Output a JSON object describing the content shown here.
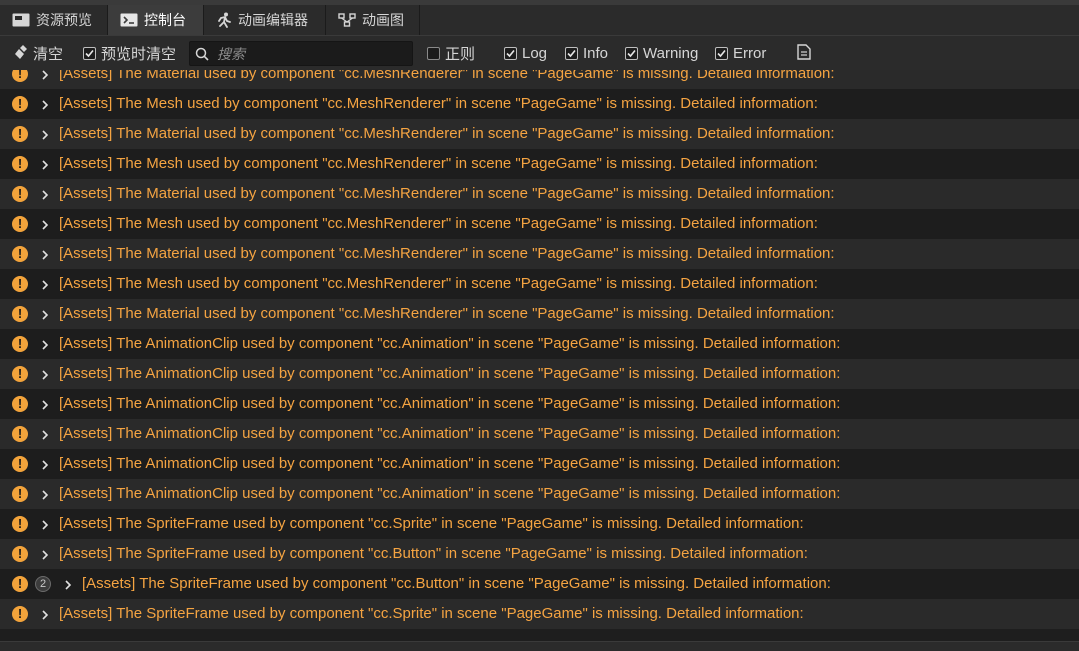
{
  "tabs": [
    {
      "label": "资源预览",
      "icon": "image-icon"
    },
    {
      "label": "控制台",
      "icon": "terminal-icon"
    },
    {
      "label": "动画编辑器",
      "icon": "running-figure-icon"
    },
    {
      "label": "动画图",
      "icon": "graph-icon"
    }
  ],
  "toolbar": {
    "clear_label": "清空",
    "preview_clear_label": "预览时清空",
    "search_placeholder": "搜索",
    "regex_label": "正则",
    "log_label": "Log",
    "info_label": "Info",
    "warning_label": "Warning",
    "error_label": "Error"
  },
  "filters": {
    "preview_clear": true,
    "regex": false,
    "log": true,
    "info": true,
    "warning": true,
    "error": true
  },
  "colors": {
    "warning_text": "#f5a442",
    "warning_icon": "#f2a33b"
  },
  "logs": [
    {
      "text": "[Assets] The Material used by component \"cc.MeshRenderer\" in scene \"PageGame\" is missing. Detailed information:"
    },
    {
      "text": "[Assets] The Mesh used by component \"cc.MeshRenderer\" in scene \"PageGame\" is missing. Detailed information:"
    },
    {
      "text": "[Assets] The Material used by component \"cc.MeshRenderer\" in scene \"PageGame\" is missing. Detailed information:"
    },
    {
      "text": "[Assets] The Mesh used by component \"cc.MeshRenderer\" in scene \"PageGame\" is missing. Detailed information:"
    },
    {
      "text": "[Assets] The Material used by component \"cc.MeshRenderer\" in scene \"PageGame\" is missing. Detailed information:"
    },
    {
      "text": "[Assets] The Mesh used by component \"cc.MeshRenderer\" in scene \"PageGame\" is missing. Detailed information:"
    },
    {
      "text": "[Assets] The Material used by component \"cc.MeshRenderer\" in scene \"PageGame\" is missing. Detailed information:"
    },
    {
      "text": "[Assets] The Mesh used by component \"cc.MeshRenderer\" in scene \"PageGame\" is missing. Detailed information:"
    },
    {
      "text": "[Assets] The Material used by component \"cc.MeshRenderer\" in scene \"PageGame\" is missing. Detailed information:"
    },
    {
      "text": "[Assets] The AnimationClip used by component \"cc.Animation\" in scene \"PageGame\" is missing. Detailed information:"
    },
    {
      "text": "[Assets] The AnimationClip used by component \"cc.Animation\" in scene \"PageGame\" is missing. Detailed information:"
    },
    {
      "text": "[Assets] The AnimationClip used by component \"cc.Animation\" in scene \"PageGame\" is missing. Detailed information:"
    },
    {
      "text": "[Assets] The AnimationClip used by component \"cc.Animation\" in scene \"PageGame\" is missing. Detailed information:"
    },
    {
      "text": "[Assets] The AnimationClip used by component \"cc.Animation\" in scene \"PageGame\" is missing. Detailed information:"
    },
    {
      "text": "[Assets] The AnimationClip used by component \"cc.Animation\" in scene \"PageGame\" is missing. Detailed information:"
    },
    {
      "text": "[Assets] The SpriteFrame used by component \"cc.Sprite\" in scene \"PageGame\" is missing. Detailed information:"
    },
    {
      "text": "[Assets] The SpriteFrame used by component \"cc.Button\" in scene \"PageGame\" is missing. Detailed information:"
    },
    {
      "text": "[Assets] The SpriteFrame used by component \"cc.Button\" in scene \"PageGame\" is missing. Detailed information:",
      "count": "2"
    },
    {
      "text": "[Assets] The SpriteFrame used by component \"cc.Sprite\" in scene \"PageGame\" is missing. Detailed information:"
    }
  ]
}
